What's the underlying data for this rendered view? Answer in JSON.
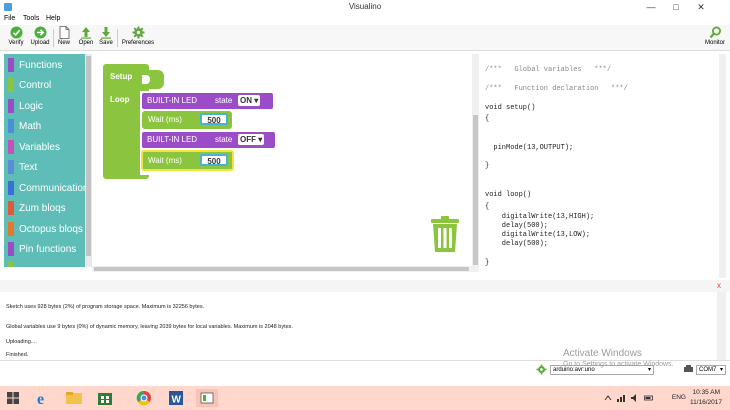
{
  "window": {
    "title": "Visualino"
  },
  "menu": [
    "File",
    "Tools",
    "Help"
  ],
  "toolbar": {
    "verify": "Verify",
    "upload": "Upload",
    "new": "New",
    "open": "Open",
    "save": "Save",
    "preferences": "Preferences",
    "monitor": "Monitor"
  },
  "palette": [
    {
      "label": "Functions",
      "color": "#9a4dc7"
    },
    {
      "label": "Control",
      "color": "#8bc53f"
    },
    {
      "label": "Logic",
      "color": "#9a4dc7"
    },
    {
      "label": "Math",
      "color": "#4a90d9"
    },
    {
      "label": "Variables",
      "color": "#c452b8"
    },
    {
      "label": "Text",
      "color": "#5b8bd9"
    },
    {
      "label": "Communication",
      "color": "#3a6fd6"
    },
    {
      "label": "Zum bloqs",
      "color": "#e25a3d"
    },
    {
      "label": "Octopus bloqs",
      "color": "#e2782b"
    },
    {
      "label": "Pin functions",
      "color": "#9a4dc7"
    }
  ],
  "blocks": {
    "setup": "Setup",
    "loop": "Loop",
    "led1": {
      "label": "BUILT-IN LED",
      "state_label": "state",
      "state": "ON"
    },
    "wait1": {
      "label": "Wait (ms)",
      "value": "500"
    },
    "led2": {
      "label": "BUILT-IN LED",
      "state_label": "state",
      "state": "OFF"
    },
    "wait2": {
      "label": "Wait (ms)",
      "value": "500"
    }
  },
  "code_lines": [
    "/***   Global variables   ***/",
    "/***   Function declaration   ***/",
    "void setup()",
    "{",
    "  pinMode(13,OUTPUT);",
    "}",
    "void loop()",
    "{",
    "    digitalWrite(13,HIGH);",
    "    delay(500);",
    "    digitalWrite(13,LOW);",
    "    delay(500);",
    "}"
  ],
  "console": {
    "close": "x",
    "lines": [
      "Sketch uses 928 bytes (2%) of program storage space. Maximum is 32256 bytes.",
      "Global variables use 9 bytes (0%) of dynamic memory, leaving 2039 bytes for local variables. Maximum is 2048 bytes.",
      "Uploading....",
      "Finished."
    ]
  },
  "status": {
    "board": "arduino:avr:uno",
    "port": "COM7",
    "watermark_title": "Activate Windows",
    "watermark_sub": "Go to Settings to activate Windows."
  },
  "taskbar": {
    "lang": "ENG",
    "time": "10:35 AM",
    "date": "11/16/2017"
  }
}
